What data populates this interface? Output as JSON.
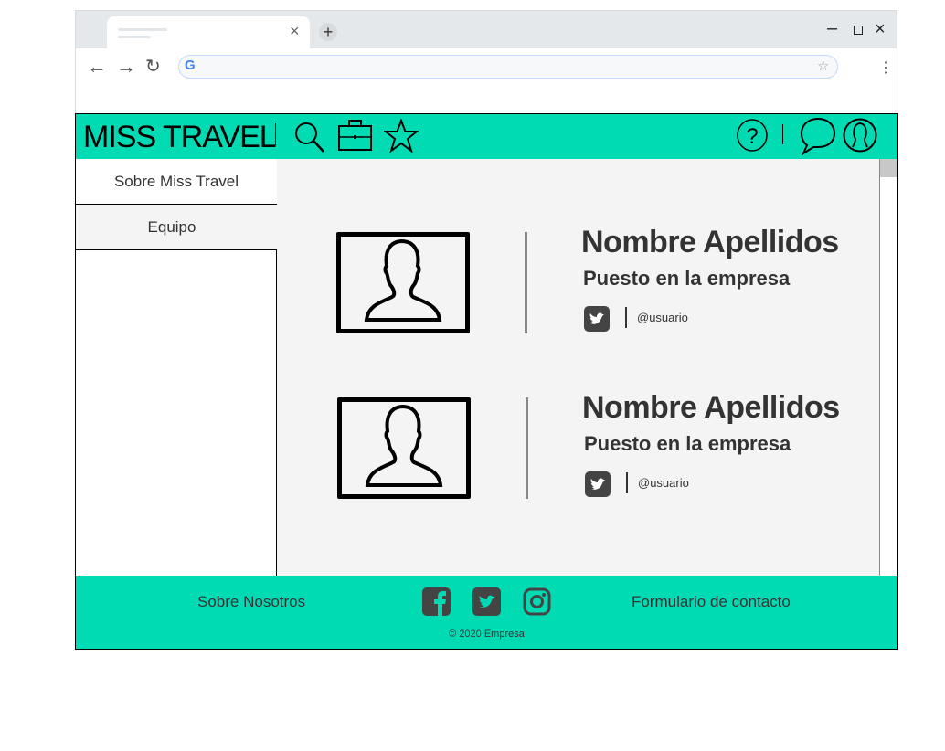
{
  "browser": {
    "icons": [
      "close-tab-icon",
      "new-tab-icon",
      "minimize-icon",
      "restore-icon",
      "close-window-icon",
      "back-icon",
      "forward-icon",
      "reload-icon",
      "google-icon",
      "bookmark-star-icon",
      "menu-icon"
    ],
    "address_value": ""
  },
  "header": {
    "logo": "MISS TRAVEL",
    "icons": [
      "search-icon",
      "briefcase-icon",
      "star-icon",
      "help-icon",
      "chat-icon",
      "user-icon"
    ]
  },
  "sidebar": {
    "items": [
      {
        "label": "Sobre Miss Travel"
      },
      {
        "label": "Equipo"
      }
    ]
  },
  "team": [
    {
      "name": "Nombre Apellidos",
      "role": "Puesto en la empresa",
      "handle": "@usuario"
    },
    {
      "name": "Nombre Apellidos",
      "role": "Puesto en la empresa",
      "handle": "@usuario"
    }
  ],
  "footer": {
    "about": "Sobre Nosotros",
    "contact": "Formulario de contacto",
    "copyright": "© 2020 Empresa",
    "social": [
      "facebook-icon",
      "twitter-icon",
      "instagram-icon"
    ]
  },
  "colors": {
    "brand": "#00dbb4",
    "content_bg": "#f4f4f4",
    "text": "#333333"
  }
}
